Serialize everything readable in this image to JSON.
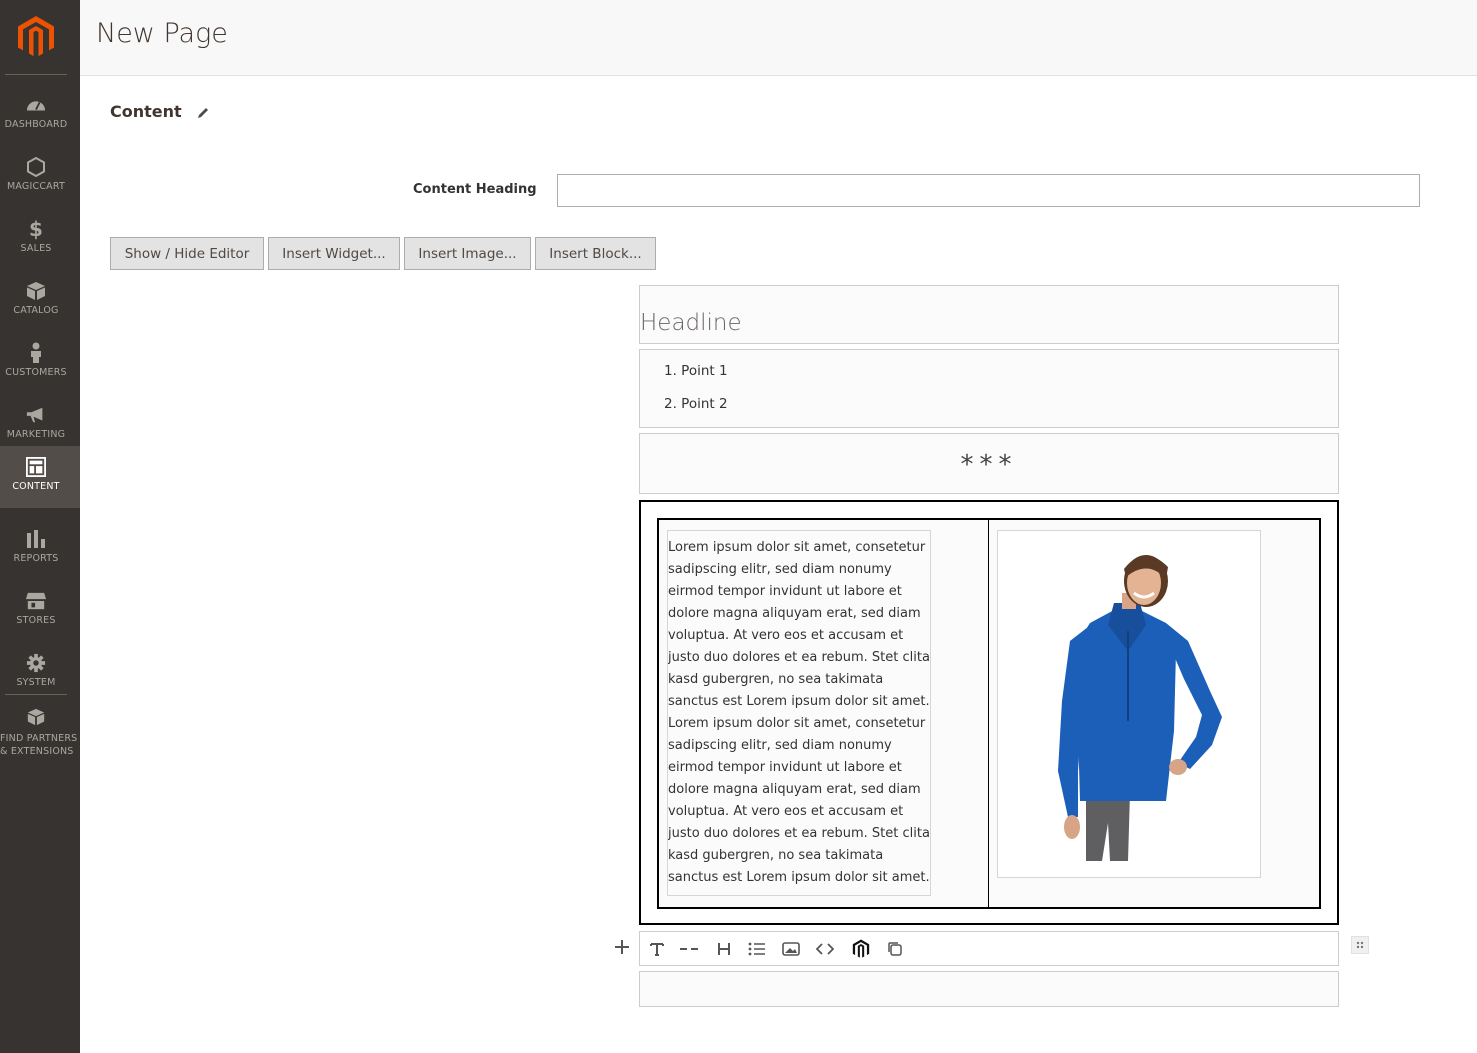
{
  "sidebar": {
    "items": [
      {
        "label": "DASHBOARD",
        "icon": "dashboard-icon"
      },
      {
        "label": "MAGICCART",
        "icon": "hexagon-icon"
      },
      {
        "label": "SALES",
        "icon": "dollar-icon"
      },
      {
        "label": "CATALOG",
        "icon": "box-icon"
      },
      {
        "label": "CUSTOMERS",
        "icon": "person-icon"
      },
      {
        "label": "MARKETING",
        "icon": "megaphone-icon"
      },
      {
        "label": "CONTENT",
        "icon": "layout-icon",
        "active": true
      },
      {
        "label": "REPORTS",
        "icon": "bar-chart-icon"
      },
      {
        "label": "STORES",
        "icon": "store-icon"
      },
      {
        "label": "SYSTEM",
        "icon": "gear-icon"
      },
      {
        "label_line1": "FIND PARTNERS",
        "label_line2": "& EXTENSIONS",
        "icon": "cubes-icon"
      }
    ]
  },
  "header": {
    "title": "New Page"
  },
  "section": {
    "title": "Content"
  },
  "form": {
    "content_heading_label": "Content Heading",
    "content_heading_value": ""
  },
  "buttons": {
    "show_hide": "Show / Hide Editor",
    "insert_widget": "Insert Widget...",
    "insert_image": "Insert Image...",
    "insert_block": "Insert Block..."
  },
  "builder": {
    "headline": "Headline",
    "list": [
      "1.  Point 1",
      "2.  Point 2"
    ],
    "divider": "***",
    "lorem_lines": [
      "Lorem ipsum dolor sit amet, consetetur",
      "sadipscing elitr, sed diam nonumy",
      "eirmod tempor invidunt ut labore et",
      "dolore magna aliquyam erat, sed diam",
      "voluptua. At vero eos et accusam et",
      "justo duo dolores et ea rebum. Stet clita",
      "kasd gubergren, no sea takimata",
      "sanctus est Lorem ipsum dolor sit amet.",
      "Lorem ipsum dolor sit amet, consetetur",
      "sadipscing elitr, sed diam nonumy",
      "eirmod tempor invidunt ut labore et",
      "dolore magna aliquyam erat, sed diam",
      "voluptua. At vero eos et accusam et",
      "justo duo dolores et ea rebum. Stet clita",
      "kasd gubergren, no sea takimata",
      "sanctus est Lorem ipsum dolor sit amet."
    ],
    "toolbar_icons": [
      "text-icon",
      "divider-icon",
      "heading-icon",
      "list-icon",
      "image-icon",
      "code-icon",
      "magento-icon",
      "copy-icon"
    ]
  },
  "colors": {
    "sidebar_bg": "#373330",
    "brand_orange": "#eb5202",
    "jacket_blue": "#1c5fb8"
  }
}
